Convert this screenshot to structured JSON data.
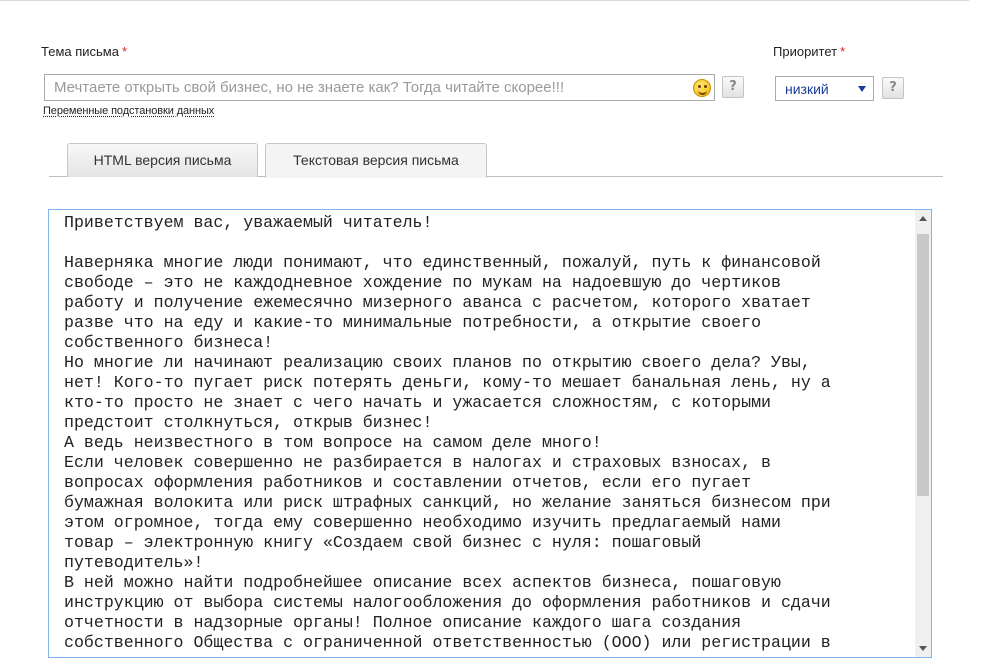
{
  "subject": {
    "label": "Тема письма",
    "required_mark": "*",
    "placeholder": "Мечтаете открыть свой бизнес, но не знаете как? Тогда читайте скорее!!!",
    "emoji_icon": "smiley-icon",
    "help_label": "?",
    "variables_link": "Переменные подстановки данных"
  },
  "priority": {
    "label": "Приоритет",
    "required_mark": "*",
    "selected": "низкий",
    "help_label": "?"
  },
  "tabs": [
    {
      "label": "HTML версия письма",
      "active": false
    },
    {
      "label": "Текстовая версия письма",
      "active": true
    }
  ],
  "editor": {
    "text": "Приветствуем вас, уважаемый читатель!\n\nНаверняка многие люди понимают, что единственный, пожалуй, путь к финансовой\nсвободе – это не каждодневное хождение по мукам на надоевшую до чертиков\nработу и получение ежемесячно мизерного аванса с расчетом, которого хватает\nразве что на еду и какие-то минимальные потребности, а открытие своего\nсобственного бизнеса!\nНо многие ли начинают реализацию своих планов по открытию своего дела? Увы,\nнет! Кого-то пугает риск потерять деньги, кому-то мешает банальная лень, ну а\nкто-то просто не знает с чего начать и ужасается сложностям, с которыми\nпредстоит столкнуться, открыв бизнес!\nА ведь неизвестного в том вопросе на самом деле много!\nЕсли человек совершенно не разбирается в налогах и страховых взносах, в\nвопросах оформления работников и составлении отчетов, если его пугает\nбумажная волокита или риск штрафных санкций, но желание заняться бизнесом при\nэтом огромное, тогда ему совершенно необходимо изучить предлагаемый нами\nтовар – электронную книгу «Создаем свой бизнес с нуля: пошаговый\nпутеводитель»!\nВ ней можно найти подробнейшее описание всех аспектов бизнеса, пошаговую\nинструкцию от выбора системы налогообложения до оформления работников и сдачи\nотчетности в надзорные органы! Полное описание каждого шага создания\nсобственного Общества с ограниченной ответственностью (ООО) или регистрации в"
  }
}
